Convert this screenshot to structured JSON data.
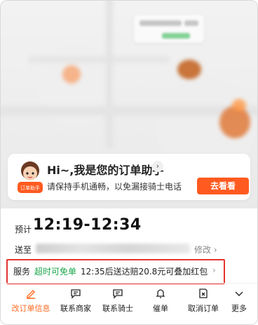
{
  "assistant": {
    "title": "Hi~,我是您的订单助手",
    "subtitle": "请保持手机通畅，以免漏接骑士电话",
    "button": "去看看",
    "mascot_text": "订单助手"
  },
  "order": {
    "eta_label": "预计",
    "eta_time": "12:19-12:34",
    "address_label": "送至",
    "edit_label": "修改"
  },
  "service": {
    "label": "服务",
    "tag": "超时可免单",
    "description": "12:35后送达赔20.8元可叠加红包"
  },
  "actions": [
    {
      "label": "改订单信息",
      "icon": "pencil-icon"
    },
    {
      "label": "联系商家",
      "icon": "chat-icon"
    },
    {
      "label": "联系骑士",
      "icon": "chat-icon"
    },
    {
      "label": "催单",
      "icon": "bell-icon"
    },
    {
      "label": "取消订单",
      "icon": "cancel-doc-icon"
    },
    {
      "label": "更多",
      "icon": "chevron-down-icon"
    }
  ],
  "colors": {
    "accent": "#ff5a1f",
    "service_tag": "#1aa64a",
    "highlight_border": "#e3342f"
  }
}
